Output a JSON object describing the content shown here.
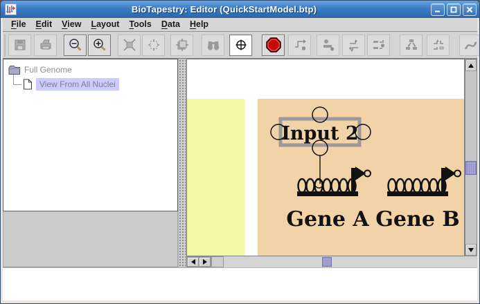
{
  "window": {
    "title": "BioTapestry: Editor (QuickStartModel.btp)"
  },
  "menu": {
    "items": [
      {
        "first": "F",
        "rest": "ile"
      },
      {
        "first": "E",
        "rest": "dit"
      },
      {
        "first": "V",
        "rest": "iew"
      },
      {
        "first": "L",
        "rest": "ayout"
      },
      {
        "first": "T",
        "rest": "ools"
      },
      {
        "first": "D",
        "rest": "ata"
      },
      {
        "first": "H",
        "rest": "elp"
      }
    ]
  },
  "toolbar": {
    "buttons": [
      {
        "name": "save",
        "enabled": false
      },
      {
        "name": "print",
        "enabled": false
      },
      {
        "name": "zoom-out",
        "enabled": true
      },
      {
        "name": "zoom-in",
        "enabled": true
      },
      {
        "name": "zoom-to-current-model",
        "enabled": false
      },
      {
        "name": "zoom-to-all-models",
        "enabled": false
      },
      {
        "name": "zoom-to-current-selection",
        "enabled": false
      },
      {
        "name": "search",
        "enabled": false
      },
      {
        "name": "center-on-crosshair",
        "enabled": true
      },
      {
        "name": "stop",
        "enabled": true
      },
      {
        "name": "add-link",
        "enabled": false
      },
      {
        "name": "add-node",
        "enabled": false
      },
      {
        "name": "add-gene",
        "enabled": false
      },
      {
        "name": "add-network-module",
        "enabled": false
      },
      {
        "name": "propagate-down",
        "enabled": false
      },
      {
        "name": "pull-into-submodel",
        "enabled": false
      },
      {
        "name": "draw-custom-link",
        "enabled": false
      }
    ]
  },
  "sidebar": {
    "tree": {
      "root_label": "Full Genome",
      "child_label": "View From All Nuclei",
      "selected": "View From All Nuclei"
    }
  },
  "canvas": {
    "input_box": {
      "label": "Input 2"
    },
    "genes": [
      {
        "label": "Gene A"
      },
      {
        "label": "Gene B"
      }
    ],
    "regions": [
      {
        "name": "yellow-region",
        "color": "#F4F7A6"
      },
      {
        "name": "orange-region",
        "color": "#F2D3A7"
      }
    ]
  },
  "colors": {
    "titlebar_blue": "#3B7CC4",
    "selection_lavender": "#CCCCFF",
    "canvas_yellow": "#F4F7A6",
    "canvas_orange": "#F2D3A7",
    "stop_red": "#C40A0A",
    "module_box_gray": "#9A9A9A"
  }
}
